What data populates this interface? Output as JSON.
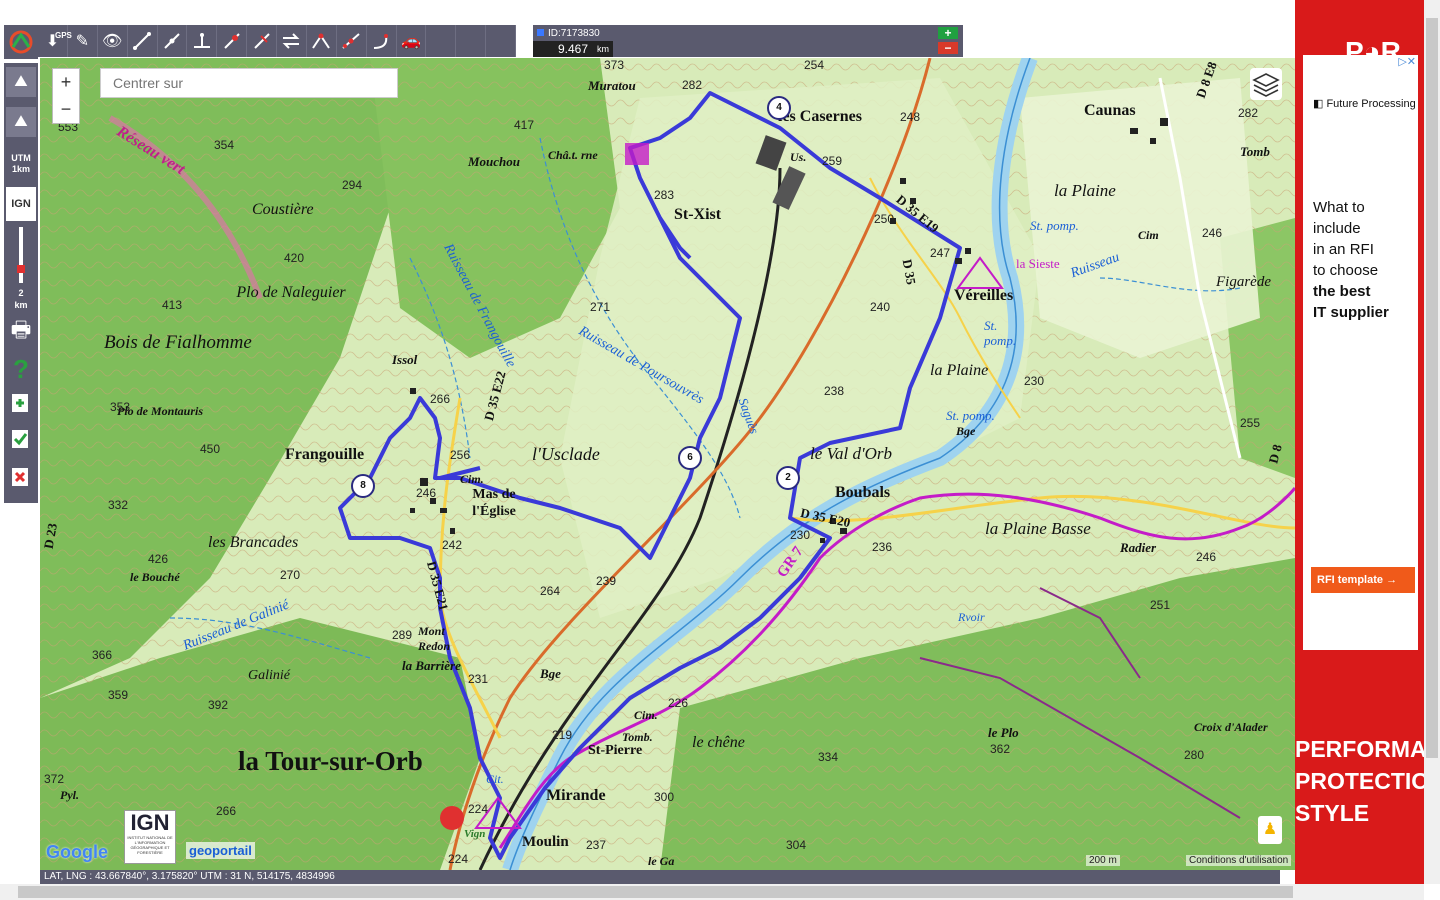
{
  "toolbar": {
    "gps_label": "GPS",
    "buttons": [
      "eye-icon",
      "draw-line-icon",
      "add-point-icon",
      "insert-point-icon",
      "delete-point-icon",
      "cut-line-icon",
      "reverse-icon",
      "join-icon",
      "split-icon",
      "snap-icon",
      "car-icon"
    ]
  },
  "track_panel": {
    "id": "ID:7173830",
    "distance": "9.467",
    "unit": "km",
    "plus": "+",
    "minus": "−"
  },
  "sidebar": {
    "utm_label": "UTM\n1km",
    "ign_label": "IGN",
    "scale_value": "2",
    "scale_unit": "km",
    "help": "?"
  },
  "map": {
    "search_placeholder": "Centrer sur",
    "zoom_in": "+",
    "zoom_out": "−",
    "scale": "200 m",
    "terms": "Conditions d'utilisation",
    "google": "Google",
    "ign_badge": "IGN",
    "ign_small": "INSTITUT NATIONAL DE L'INFORMATION GÉOGRAPHIQUE ET FORESTIÈRE",
    "geoportail": "geoportail",
    "route_color": "#3a3ad8",
    "gr_color": "#c41cc8",
    "waypoints": [
      "4",
      "2",
      "6",
      "8"
    ],
    "place_names": [
      "la Tour-sur-Orb",
      "Frangouille",
      "Boubals",
      "Caunas",
      "les Casernes",
      "St-Xist",
      "Véreilles",
      "Mirande",
      "St-Pierre",
      "Moulin",
      "Mas de l'Église",
      "Muratou",
      "Mouchou",
      "Châ.t. rne",
      "Coustière",
      "Plo de Naleguier",
      "Bois de Fialhomme",
      "Plo de Montauris",
      "les Brancades",
      "le Bouché",
      "Galinié",
      "Mont Redon",
      "la Barrière",
      "l'Usclade",
      "le Val d'Orb",
      "la Plaine",
      "la Plaine Basse",
      "Radier",
      "Figarède",
      "Tomb",
      "la Sieste",
      "Croix d'Alader",
      "le Plo",
      "le chêne",
      "Issol",
      "Cim.",
      "Bge",
      "Us.",
      "Réseau vert",
      "Pyl.",
      "Cit.",
      "Rvoir",
      "St. pomp.",
      "Tomb.",
      "Cim",
      "GR 7",
      "le Ga",
      "Vign",
      "Ruisseau de Frangouille",
      "Ruisseau de Poursouvrès",
      "Saguès",
      "Ruisseau",
      "Ruisseau de Galinié"
    ],
    "roads": [
      "D 35 E22",
      "D 35 E21",
      "D 35 E20",
      "D 35 E19",
      "D 35",
      "D 8 E8",
      "D 23",
      "D 8"
    ],
    "altitudes": [
      "373",
      "282",
      "254",
      "417",
      "354",
      "294",
      "283",
      "259",
      "248",
      "282",
      "553",
      "420",
      "413",
      "353",
      "450",
      "332",
      "426",
      "270",
      "289",
      "366",
      "359",
      "392",
      "372",
      "266",
      "224",
      "231",
      "219",
      "226",
      "250",
      "247",
      "240",
      "238",
      "230",
      "236",
      "255",
      "246",
      "251",
      "280",
      "334",
      "362",
      "304",
      "300",
      "237",
      "224",
      "264",
      "239",
      "256",
      "266",
      "271",
      "242",
      "246"
    ]
  },
  "coords_bar": "LAT, LNG : 43.667840°, 3.175820°      UTM : 31 N, 514175, 4834996",
  "ad": {
    "brand": "Future Processing",
    "lines": [
      "What to",
      "include",
      "in an RFI",
      "to choose"
    ],
    "bold_lines": [
      "the best",
      "IT supplier"
    ],
    "button": "RFI template",
    "logo": "P◕R",
    "big": [
      "PERFORMA",
      "PROTECTIO",
      "STYLE"
    ]
  }
}
